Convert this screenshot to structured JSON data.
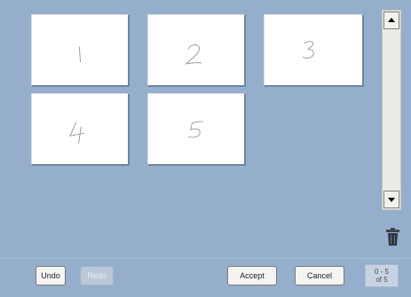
{
  "thumbnails": [
    {
      "label": "1"
    },
    {
      "label": "2"
    },
    {
      "label": "3"
    },
    {
      "label": "4"
    },
    {
      "label": "5"
    }
  ],
  "scrollbar": {
    "up_icon": "arrow-up-icon",
    "down_icon": "arrow-down-icon"
  },
  "trash": {
    "icon": "trash-can-icon"
  },
  "toolbar": {
    "undo_label": "Undo",
    "redo_label": "Redo",
    "accept_label": "Accept",
    "cancel_label": "Cancel",
    "page_range": "0 - 5",
    "page_total": "of 5"
  },
  "colors": {
    "background": "#95aecb",
    "thumbnail": "#ffffff",
    "disabled_button": "#b9c7d8"
  }
}
